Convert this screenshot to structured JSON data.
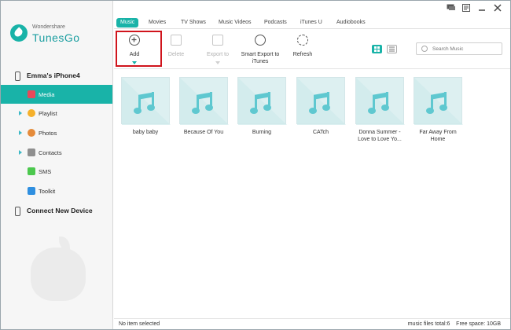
{
  "brand": {
    "small": "Wondershare",
    "big": "TunesGo"
  },
  "device": {
    "name": "Emma's iPhone4"
  },
  "sidebar": {
    "items": [
      {
        "label": "Media",
        "icon": "music-note-icon",
        "color": "#e9495a",
        "active": true
      },
      {
        "label": "Playlist",
        "icon": "playlist-icon",
        "color": "#f5b02b"
      },
      {
        "label": "Photos",
        "icon": "photos-icon",
        "color": "#e58b3a"
      },
      {
        "label": "Contacts",
        "icon": "contacts-icon",
        "color": "#8f8f8f"
      },
      {
        "label": "SMS",
        "icon": "sms-icon",
        "color": "#4cc84e"
      },
      {
        "label": "Toolkit",
        "icon": "toolkit-icon",
        "color": "#2f8fe0"
      }
    ],
    "connect": "Connect New Device"
  },
  "tabs": [
    {
      "label": "Music",
      "active": true
    },
    {
      "label": "Movies"
    },
    {
      "label": "TV Shows"
    },
    {
      "label": "Music Videos"
    },
    {
      "label": "Podcasts"
    },
    {
      "label": "iTunes U"
    },
    {
      "label": "Audiobooks"
    }
  ],
  "toolbar": {
    "add": "Add",
    "delete": "Delete",
    "export": "Export to",
    "smart_export_line1": "Smart Export to",
    "smart_export_line2": "iTunes",
    "refresh": "Refresh"
  },
  "search": {
    "placeholder": "Search Music"
  },
  "songs": [
    {
      "title_line1": "baby baby",
      "title_line2": ""
    },
    {
      "title_line1": "Because Of You",
      "title_line2": ""
    },
    {
      "title_line1": "Burning",
      "title_line2": ""
    },
    {
      "title_line1": "CATch",
      "title_line2": ""
    },
    {
      "title_line1": "Donna Summer -",
      "title_line2": "Love to Love Yo..."
    },
    {
      "title_line1": "Far Away From",
      "title_line2": "Home"
    }
  ],
  "status": {
    "left": "No item selected",
    "right": "music files total:6    Free space: 10GB"
  },
  "colors": {
    "accent": "#19b3a8",
    "highlight_frame": "#d0141c"
  }
}
